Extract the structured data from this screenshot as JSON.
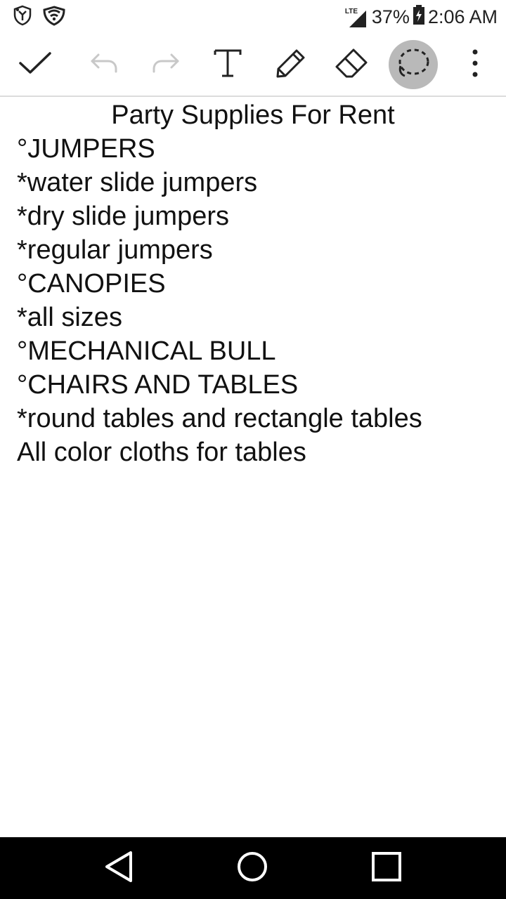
{
  "status_bar": {
    "network_label": "LTE",
    "battery_percent": "37%",
    "time": "2:06 AM",
    "icons": [
      "shield-icon",
      "wifi-icon",
      "cell-signal-icon",
      "battery-charging-icon"
    ]
  },
  "toolbar": {
    "items": [
      {
        "name": "done",
        "icon": "checkmark-icon"
      },
      {
        "name": "undo",
        "icon": "undo-icon",
        "enabled": false
      },
      {
        "name": "redo",
        "icon": "redo-icon",
        "enabled": false
      },
      {
        "name": "text",
        "icon": "text-icon"
      },
      {
        "name": "pen",
        "icon": "pencil-icon"
      },
      {
        "name": "eraser",
        "icon": "eraser-icon"
      },
      {
        "name": "lasso",
        "icon": "lasso-select-icon",
        "active": true
      },
      {
        "name": "more",
        "icon": "more-vert-icon"
      }
    ],
    "active_color": "#b9b9b9"
  },
  "note": {
    "title": "Party Supplies For Rent",
    "lines": [
      "°JUMPERS",
      "*water slide jumpers",
      "*dry slide jumpers",
      "*regular jumpers",
      "°CANOPIES",
      "*all sizes",
      "°MECHANICAL BULL",
      "°CHAIRS AND TABLES",
      "*round tables and rectangle tables",
      "All color cloths for tables"
    ]
  },
  "nav_bar": {
    "items": [
      "back-icon",
      "home-icon",
      "recents-icon"
    ],
    "background": "#000000"
  }
}
